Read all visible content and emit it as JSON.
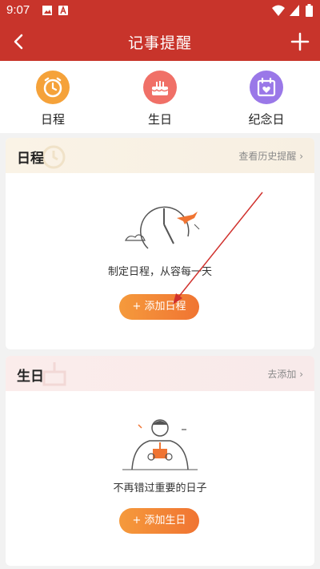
{
  "status": {
    "time": "9:07"
  },
  "appbar": {
    "title": "记事提醒"
  },
  "categories": [
    {
      "label": "日程",
      "icon": "alarm-clock-icon",
      "color": "#f5a23a"
    },
    {
      "label": "生日",
      "icon": "cake-icon",
      "color": "#f07067"
    },
    {
      "label": "纪念日",
      "icon": "calendar-heart-icon",
      "color": "#9a78e8"
    }
  ],
  "schedule": {
    "title": "日程",
    "link": "查看历史提醒",
    "desc": "制定日程，从容每一天",
    "button": "+ 添加日程"
  },
  "birthday": {
    "title": "生日",
    "link": "去添加",
    "desc": "不再错过重要的日子",
    "button": "+ 添加生日"
  },
  "colors": {
    "brand": "#c8342b",
    "accent": "#f07432"
  }
}
